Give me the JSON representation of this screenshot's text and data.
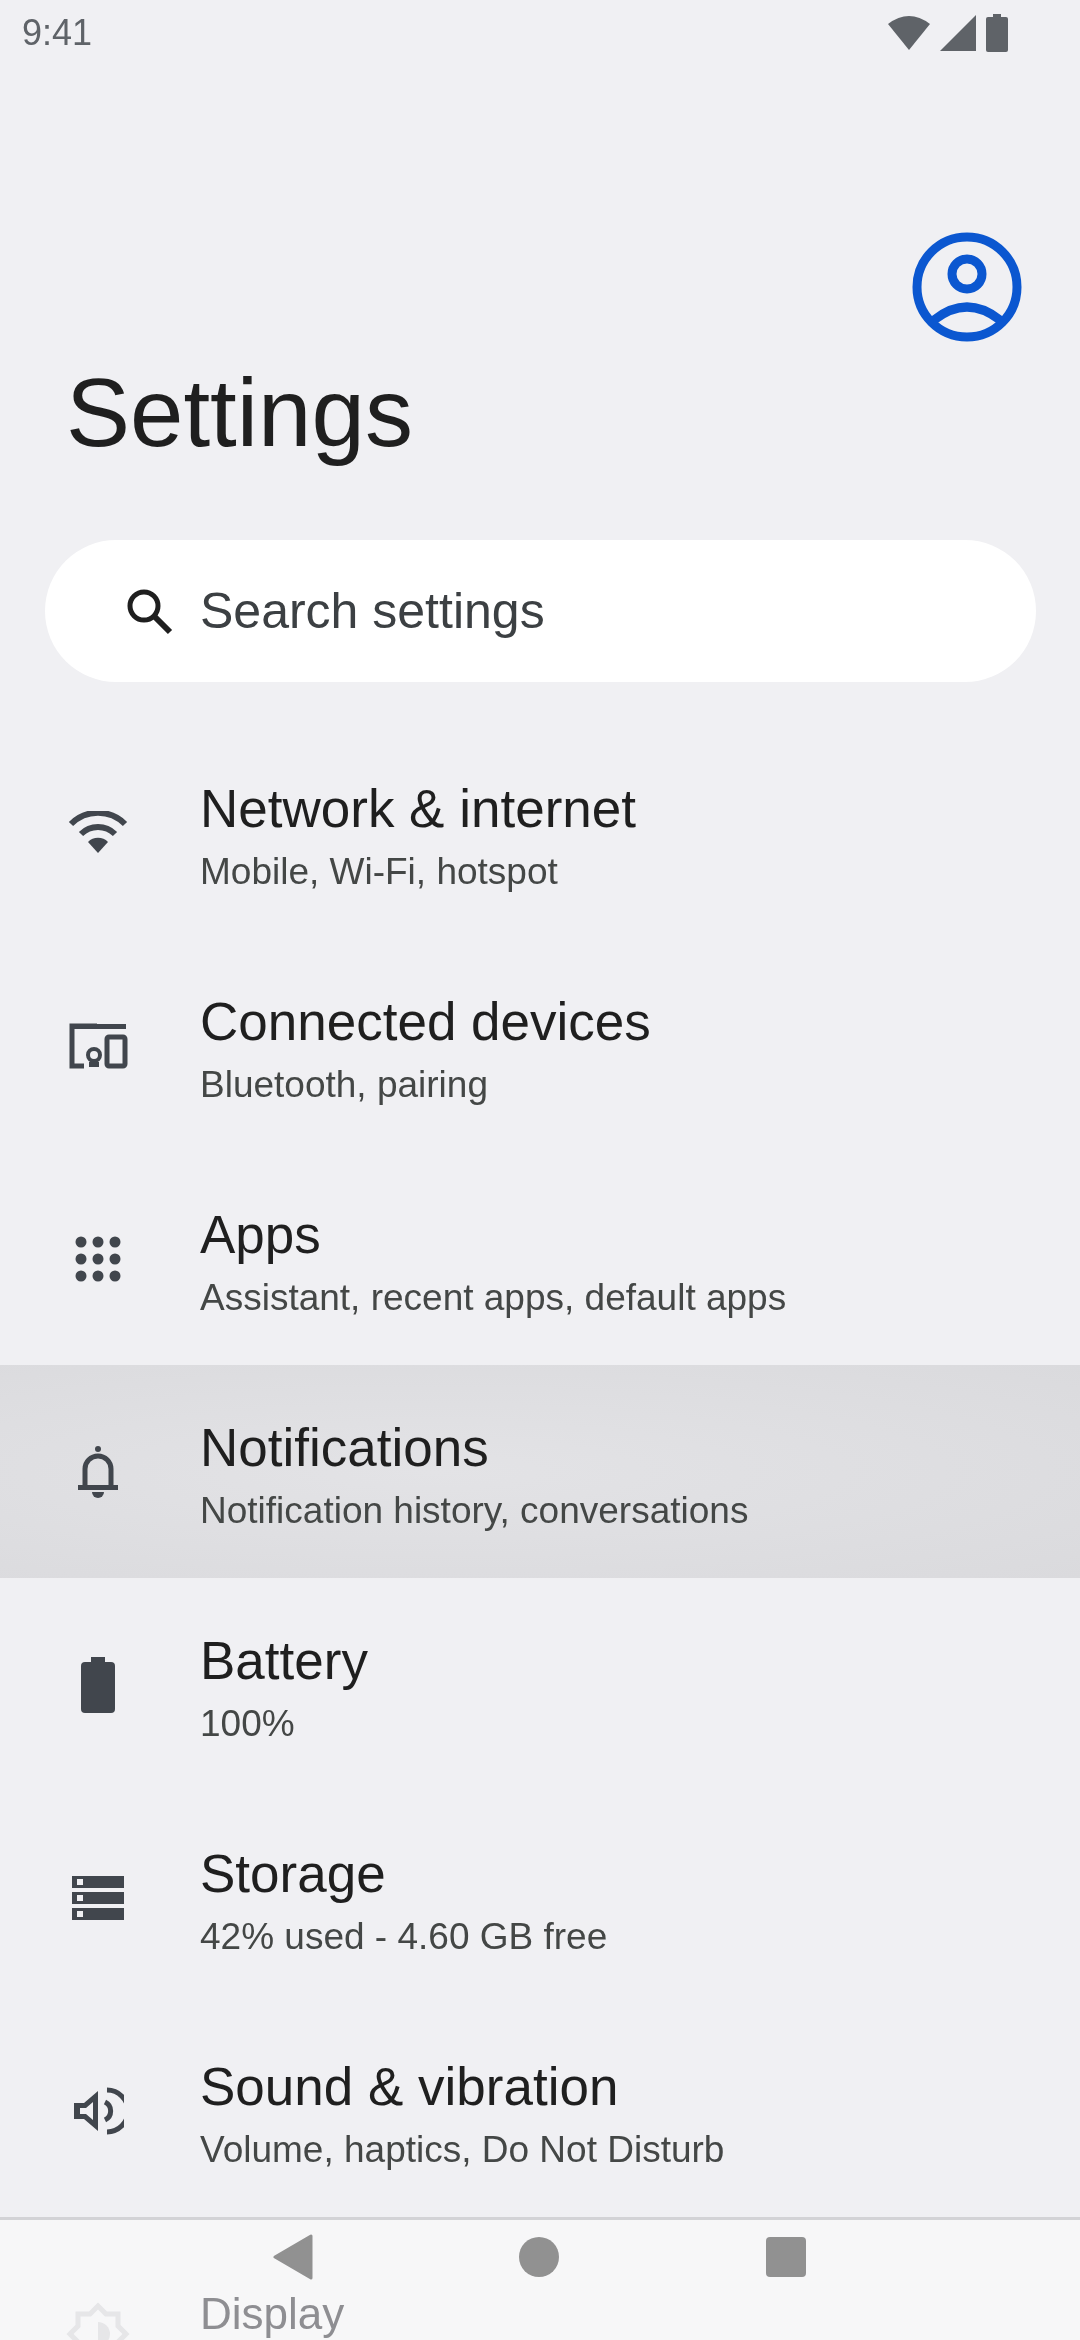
{
  "status_bar": {
    "time": "9:41"
  },
  "title": "Settings",
  "search": {
    "placeholder": "Search settings"
  },
  "items": [
    {
      "kind": "wifi",
      "title": "Network & internet",
      "subtitle": "Mobile, Wi-Fi, hotspot",
      "selected": false
    },
    {
      "kind": "devices",
      "title": "Connected devices",
      "subtitle": "Bluetooth, pairing",
      "selected": false
    },
    {
      "kind": "apps",
      "title": "Apps",
      "subtitle": "Assistant, recent apps, default apps",
      "selected": false
    },
    {
      "kind": "bell",
      "title": "Notifications",
      "subtitle": "Notification history, conversations",
      "selected": true
    },
    {
      "kind": "battery",
      "title": "Battery",
      "subtitle": "100%",
      "selected": false
    },
    {
      "kind": "storage",
      "title": "Storage",
      "subtitle": "42% used - 4.60 GB free",
      "selected": false
    },
    {
      "kind": "sound",
      "title": "Sound & vibration",
      "subtitle": "Volume, haptics, Do Not Disturb",
      "selected": false
    },
    {
      "kind": "display",
      "title": "Display",
      "selected": false
    }
  ]
}
